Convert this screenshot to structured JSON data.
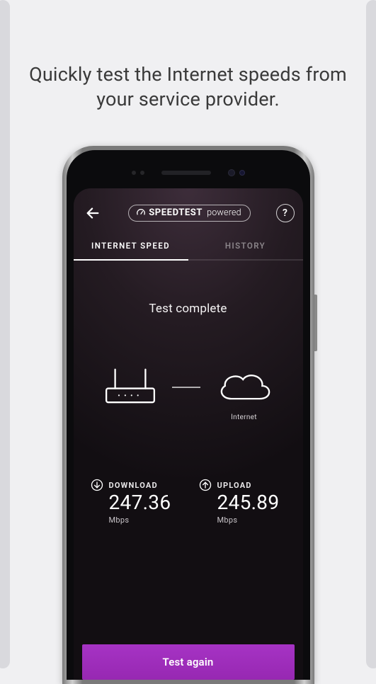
{
  "promo": {
    "caption": "Quickly test the Internet speeds from your service provider."
  },
  "header": {
    "badge_strong": "SPEEDTEST",
    "badge_light": "powered"
  },
  "tabs": {
    "speed": "INTERNET SPEED",
    "history": "HISTORY"
  },
  "status": "Test complete",
  "diagram": {
    "router_label": "",
    "internet_label": "Internet"
  },
  "metrics": {
    "download": {
      "label": "DOWNLOAD",
      "value": "247.36",
      "unit": "Mbps"
    },
    "upload": {
      "label": "UPLOAD",
      "value": "245.89",
      "unit": "Mbps"
    }
  },
  "actions": {
    "test_again": "Test again"
  },
  "help": "?"
}
